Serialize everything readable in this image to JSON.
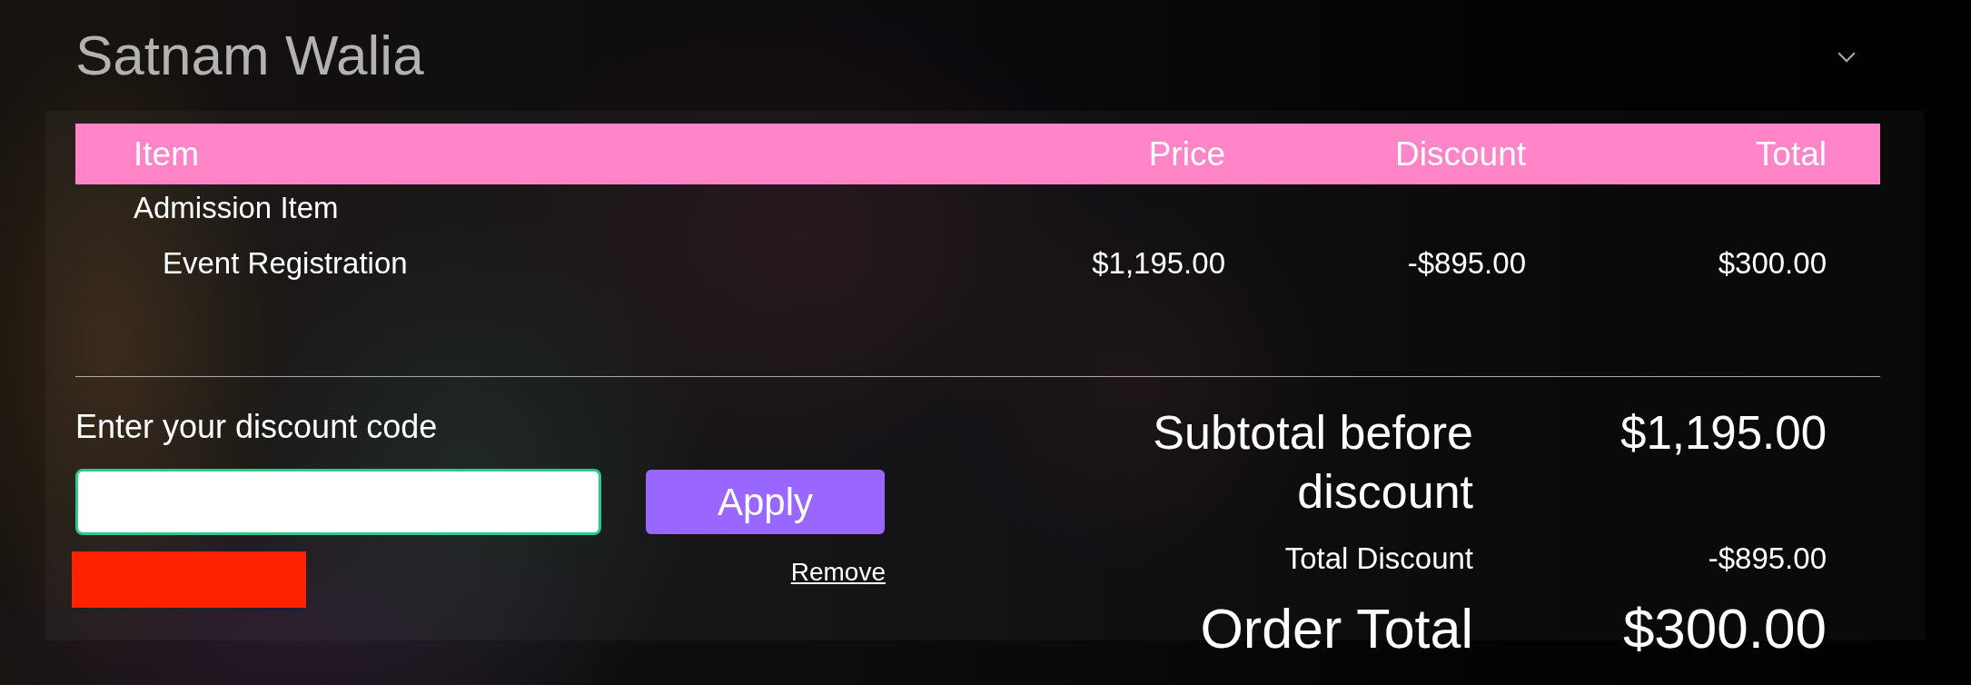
{
  "attendee": {
    "name": "Satnam Walia"
  },
  "table": {
    "columns": [
      "Item",
      "Price",
      "Discount",
      "Total"
    ],
    "rows": [
      {
        "item": "Admission Item",
        "children": [
          {
            "item": "Event Registration",
            "price": "$1,195.00",
            "discount": "-$895.00",
            "total": "$300.00"
          }
        ]
      }
    ]
  },
  "discount_form": {
    "label": "Enter your discount code",
    "apply_button": "Apply",
    "remove_link": "Remove"
  },
  "totals": [
    {
      "kind": "subtotal",
      "label": "Subtotal before discount",
      "value": "$1,195.00"
    },
    {
      "kind": "discount",
      "label": "Total Discount",
      "value": "-$895.00"
    },
    {
      "kind": "grand_total",
      "label": "Order Total",
      "value": "$300.00"
    }
  ]
}
